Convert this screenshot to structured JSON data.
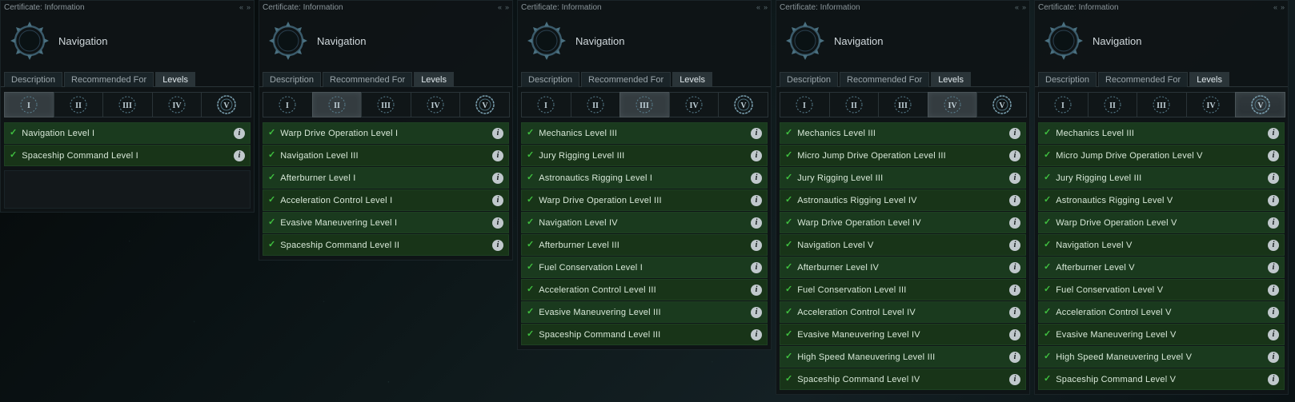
{
  "window_title": "Certificate: Information",
  "certificate_name": "Navigation",
  "tabs": {
    "description": "Description",
    "recommended": "Recommended For",
    "levels": "Levels"
  },
  "level_labels": [
    "I",
    "II",
    "III",
    "IV",
    "V"
  ],
  "panels": [
    {
      "active_level": 0,
      "skills": [
        "Navigation Level I",
        "Spaceship Command Level I"
      ]
    },
    {
      "active_level": 1,
      "skills": [
        "Warp Drive Operation Level I",
        "Navigation Level III",
        "Afterburner Level I",
        "Acceleration Control Level I",
        "Evasive Maneuvering Level I",
        "Spaceship Command Level II"
      ]
    },
    {
      "active_level": 2,
      "skills": [
        "Mechanics Level III",
        "Jury Rigging Level III",
        "Astronautics Rigging Level I",
        "Warp Drive Operation Level III",
        "Navigation Level IV",
        "Afterburner Level III",
        "Fuel Conservation Level I",
        "Acceleration Control Level III",
        "Evasive Maneuvering Level III",
        "Spaceship Command Level III"
      ]
    },
    {
      "active_level": 3,
      "skills": [
        "Mechanics Level III",
        "Micro Jump Drive Operation Level III",
        "Jury Rigging Level III",
        "Astronautics Rigging Level IV",
        "Warp Drive Operation Level IV",
        "Navigation Level V",
        "Afterburner Level IV",
        "Fuel Conservation Level III",
        "Acceleration Control Level IV",
        "Evasive Maneuvering Level IV",
        "High Speed Maneuvering Level III",
        "Spaceship Command Level IV"
      ]
    },
    {
      "active_level": 4,
      "skills": [
        "Mechanics Level III",
        "Micro Jump Drive Operation Level V",
        "Jury Rigging Level III",
        "Astronautics Rigging Level V",
        "Warp Drive Operation Level V",
        "Navigation Level V",
        "Afterburner Level V",
        "Fuel Conservation Level V",
        "Acceleration Control Level V",
        "Evasive Maneuvering Level V",
        "High Speed Maneuvering Level V",
        "Spaceship Command Level V"
      ]
    }
  ]
}
